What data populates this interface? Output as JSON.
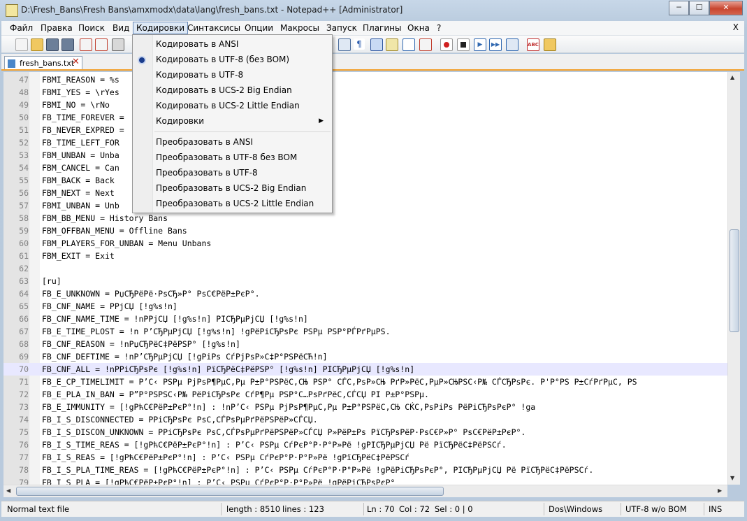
{
  "window": {
    "title": "D:\\Fresh_Bans\\Fresh Bans\\amxmodx\\data\\lang\\fresh_bans.txt - Notepad++ [Administrator]",
    "minimize": "─",
    "maximize": "☐",
    "close": "✕"
  },
  "menubar": {
    "items": [
      "Файл",
      "Правка",
      "Поиск",
      "Вид",
      "Кодировки",
      "Синтаксисы",
      "Опции",
      "Макросы",
      "Запуск",
      "Плагины",
      "Окна",
      "?"
    ],
    "close_x": "X"
  },
  "tab": {
    "label": "fresh_bans.txt",
    "close": "✕"
  },
  "encoding_menu": {
    "items": [
      "Кодировать в ANSI",
      "Кодировать в UTF-8 (без BOM)",
      "Кодировать в UTF-8",
      "Кодировать в UCS-2 Big Endian",
      "Кодировать в UCS-2 Little Endian",
      "Кодировки",
      "Преобразовать в ANSI",
      "Преобразовать в UTF-8 без BOM",
      "Преобразовать в UTF-8",
      "Преобразовать в UCS-2 Big Endian",
      "Преобразовать в UCS-2 Little Endian"
    ],
    "checked_item": "Кодировать в UTF-8 (без BOM)",
    "submenu_arrow": "▶"
  },
  "editor": {
    "current_line": 70,
    "lines": [
      {
        "n": "47",
        "text": "FBMI_REASON = %s"
      },
      {
        "n": "48",
        "text": "FBMI_YES = \\rYes"
      },
      {
        "n": "49",
        "text": "FBMI_NO = \\rNo"
      },
      {
        "n": "50",
        "text": "FB_TIME_FOREVER ="
      },
      {
        "n": "51",
        "text": "FB_NEVER_EXPRED ="
      },
      {
        "n": "52",
        "text": "FB_TIME_LEFT_FOR"
      },
      {
        "n": "53",
        "text": "FBM_UNBAN = Unba"
      },
      {
        "n": "54",
        "text": "FBM_CANCEL = Can"
      },
      {
        "n": "55",
        "text": "FBM_BACK = Back"
      },
      {
        "n": "56",
        "text": "FBM_NEXT = Next"
      },
      {
        "n": "57",
        "text": "FBMI_UNBAN = Unb"
      },
      {
        "n": "58",
        "text": "FBM_BB_MENU = History Bans"
      },
      {
        "n": "59",
        "text": "FBM_OFFBAN_MENU = Offline Bans"
      },
      {
        "n": "60",
        "text": "FBM_PLAYERS_FOR_UNBAN = Menu Unbans"
      },
      {
        "n": "61",
        "text": "FBM_EXIT = Exit"
      },
      {
        "n": "62",
        "text": ""
      },
      {
        "n": "63",
        "text": "[ru]"
      },
      {
        "n": "64",
        "text": "FB_E_UNKNOWN = РџСЂРёРё·РѕСЂ»Р° РѕС€РёР±РєР°."
      },
      {
        "n": "65",
        "text": "FB_CNF_NAME = РРјСЏ [!g%s!n]"
      },
      {
        "n": "66",
        "text": "FB_CNF_NAME_TIME = !nРРјСЏ [!g%s!n] РІСЂРµРјСЏ [!g%s!n]"
      },
      {
        "n": "67",
        "text": "FB_E_TIME_PLOST = !n Р’СЂРµРјСЏ [!g%s!n] !gРёРіСЂРѕРє РЅРµ РЅР°РЃРґРµРЅ."
      },
      {
        "n": "68",
        "text": "FB_CNF_REASON = !nРџСЂРёС‡РёРЅР° [!g%s!n]"
      },
      {
        "n": "69",
        "text": "FB_CNF_DEFTIME = !nР’СЂРµРјСЏ [!gРіРѕ СѓРјРѕР»С‡Р°РЅРёСЋ!n]"
      },
      {
        "n": "70",
        "text": "FB_CNF_ALL = !nРРіСЂРѕРє [!g%s!n] РїСЂРёС‡РёРЅР° [!g%s!n] РІСЂРµРјСЏ [!g%s!n]"
      },
      {
        "n": "71",
        "text": "FB_E_CP_TIMELIMIT = Р’С‹ РЅРµ РјРѕР¶РµС‚Рµ Р±Р°РЅРёС‚СЊ РЅР° СЃС‚РѕР»СЊ РґР»РёС‚РµР»СЊРЅС‹Р№ СЃСЂРѕРє. Р'Р°РЅ Р±СѓРґРµС‚ РЅ"
      },
      {
        "n": "72",
        "text": "FB_E_PLA_IN_BAN = Р”Р°РЅРЅС‹Р№ РёРіСЂРѕРє СѓР¶Рµ РЅР°С…РѕРґРёС‚СЃСЏ РІ Р±Р°РЅРµ."
      },
      {
        "n": "73",
        "text": "FB_E_IMMUNITY = [!gРћС€РёР±РєР°!n] : !nР’С‹ РЅРµ РјРѕР¶РµС‚Рµ Р±Р°РЅРёС‚СЊ СЌС‚РѕРіРѕ РёРіСЂРѕРєР° !ga"
      },
      {
        "n": "74",
        "text": "FB_I_S_DISCONNECTED = РРіСЂРѕРє РѕС‚СЃРѕРµРґРёРЅРёР»СЃСЏ."
      },
      {
        "n": "75",
        "text": "FB_I_S_DISCON_UNKNOWN = РРіСЂРѕРє РѕС‚СЃРѕРµРґРёРЅРёР»СЃСЏ Р»РёР±Рѕ РїСЂРѕРёР·РѕС€Р»Р° РѕС€РёР±РєР°."
      },
      {
        "n": "76",
        "text": "FB_I_S_TIME_REAS = [!gРћС€РёР±РєР°!n] : Р’С‹ РЅРµ СѓРєР°Р·Р°Р»Рё !gРІСЂРµРјСЏ Рё РїСЂРёС‡РёРЅСѓ."
      },
      {
        "n": "77",
        "text": "FB_I_S_REAS = [!gРћС€РёР±РєР°!n] : Р’С‹ РЅРµ СѓРєР°Р·Р°Р»Рё !gРїСЂРёС‡РёРЅСѓ"
      },
      {
        "n": "78",
        "text": "FB_I_S_PLA_TIME_REAS = [!gРћС€РёР±РєР°!n] : Р’С‹ РЅРµ СѓРєР°Р·Р°Р»Рё !gРёРіСЂРѕРєР°, РІСЂРµРјСЏ Рё РїСЂРёС‡РёРЅСѓ."
      },
      {
        "n": "79",
        "text": "FB_I_S_PLA = [!gРћС€РёР±РєР°!n] : Р’С‹ РЅРµ СѓРєР°Р·Р°Р»Рё !gРёРіСЂРѕРєР°"
      }
    ]
  },
  "status": {
    "file_type": "Normal text file",
    "length": "length : 8510",
    "lines": "lines : 123",
    "ln": "Ln : 70",
    "col": "Col : 72",
    "sel": "Sel : 0 | 0",
    "eol": "Dos\\Windows",
    "encoding": "UTF-8 w/o BOM",
    "mode": "INS"
  },
  "scroll": {
    "up_arrow": "▲",
    "down_arrow": "▼",
    "left_arrow": "◀",
    "right_arrow": "▶"
  },
  "toolbar_icons": [
    "new-file-icon",
    "open-file-icon",
    "save-icon",
    "save-all-icon",
    "close-icon",
    "close-all-icon",
    "print-icon",
    "indent-guide-icon",
    "show-all-chars-icon",
    "word-wrap-icon",
    "doc-map-icon",
    "function-list-icon",
    "folder-workspace-icon",
    "record-macro-icon",
    "stop-macro-icon",
    "play-macro-icon",
    "run-macro-multiple-icon",
    "save-macro-icon",
    "spell-check-icon",
    "extra-icon"
  ]
}
